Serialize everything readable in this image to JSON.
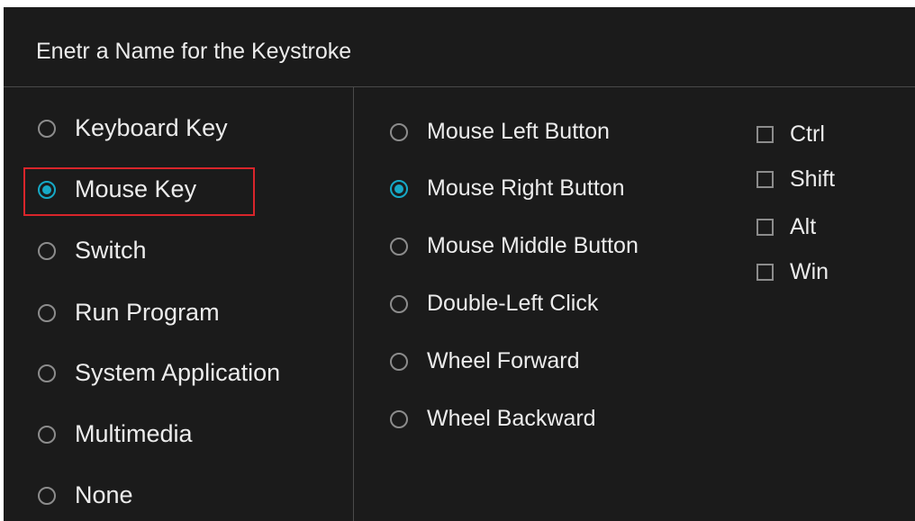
{
  "dialog": {
    "title": "Enetr a Name for the Keystroke"
  },
  "key_types": [
    {
      "label": "Keyboard Key",
      "selected": false
    },
    {
      "label": "Mouse Key",
      "selected": true
    },
    {
      "label": "Switch",
      "selected": false
    },
    {
      "label": "Run Program",
      "selected": false
    },
    {
      "label": "System Application",
      "selected": false
    },
    {
      "label": "Multimedia",
      "selected": false
    },
    {
      "label": "None",
      "selected": false
    }
  ],
  "mouse_buttons": [
    {
      "label": "Mouse Left Button",
      "selected": false
    },
    {
      "label": "Mouse Right Button",
      "selected": true
    },
    {
      "label": "Mouse Middle Button",
      "selected": false
    },
    {
      "label": "Double-Left Click",
      "selected": false
    },
    {
      "label": "Wheel Forward",
      "selected": false
    },
    {
      "label": "Wheel Backward",
      "selected": false
    }
  ],
  "modifiers": [
    {
      "label": "Ctrl",
      "checked": false
    },
    {
      "label": "Shift",
      "checked": false
    },
    {
      "label": "Alt",
      "checked": false
    },
    {
      "label": "Win",
      "checked": false
    }
  ],
  "colors": {
    "accent": "#16a9c6",
    "highlight_border": "#d9252b",
    "background": "#1b1b1b"
  }
}
